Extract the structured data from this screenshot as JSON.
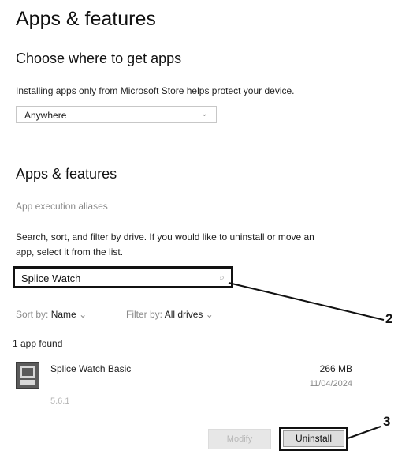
{
  "header": {
    "title": "Apps & features"
  },
  "get_apps": {
    "heading": "Choose where to get apps",
    "description": "Installing apps only from Microsoft Store helps protect your device.",
    "dropdown_value": "Anywhere"
  },
  "features": {
    "heading": "Apps & features",
    "aliases_link": "App execution aliases",
    "instructions_line1": "Search, sort, and filter by drive. If you would like to uninstall or move an",
    "instructions_line2": "app, select it from the list.",
    "search_value": "Splice Watch",
    "sort_label": "Sort by:",
    "sort_value": "Name",
    "filter_label": "Filter by:",
    "filter_value": "All drives",
    "count_text": "1 app found"
  },
  "app": {
    "name": "Splice Watch Basic",
    "size": "266 MB",
    "date": "11/04/2024",
    "version": "5.6.1",
    "modify_label": "Modify",
    "uninstall_label": "Uninstall"
  },
  "callouts": {
    "search": "2",
    "uninstall": "3"
  },
  "icons": {
    "search": "search-icon",
    "chevron": "chevron-down-icon",
    "app": "app-icon"
  },
  "colors": {
    "outline": "#111111",
    "muted": "#8a8a8a"
  }
}
